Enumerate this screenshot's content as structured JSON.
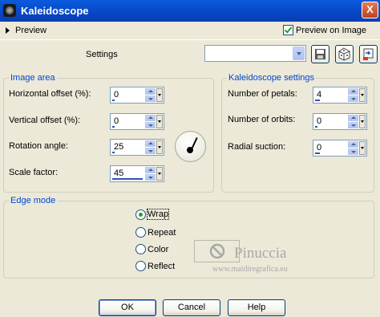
{
  "window": {
    "title": "Kaleidoscope",
    "close_glyph": "X"
  },
  "preview": {
    "label": "Preview",
    "preview_on_image_label": "Preview on Image",
    "preview_on_image_checked": true
  },
  "settings": {
    "label": "Settings",
    "preset_value": ""
  },
  "image_area": {
    "legend": "Image area",
    "horizontal_offset": {
      "label": "Horizontal offset (%):",
      "value": "0"
    },
    "vertical_offset": {
      "label": "Vertical offset (%):",
      "value": "0"
    },
    "rotation_angle": {
      "label": "Rotation angle:",
      "value": "25"
    },
    "scale_factor": {
      "label": "Scale factor:",
      "value": "45"
    }
  },
  "kaleidoscope_settings": {
    "legend": "Kaleidoscope settings",
    "number_of_petals": {
      "label": "Number of petals:",
      "value": "4"
    },
    "number_of_orbits": {
      "label": "Number of orbits:",
      "value": "0"
    },
    "radial_suction": {
      "label": "Radial suction:",
      "value": "0"
    }
  },
  "edge_mode": {
    "legend": "Edge mode",
    "options": [
      "Wrap",
      "Repeat",
      "Color",
      "Reflect"
    ],
    "selected": "Wrap"
  },
  "watermark": {
    "name": "Pinuccia",
    "url": "www.maidiregrafica.eu"
  },
  "buttons": {
    "ok": "OK",
    "cancel": "Cancel",
    "help": "Help"
  },
  "colors": {
    "titlebar": "#0846c4",
    "legend_text": "#0046d5",
    "checkmark": "#21a121"
  }
}
